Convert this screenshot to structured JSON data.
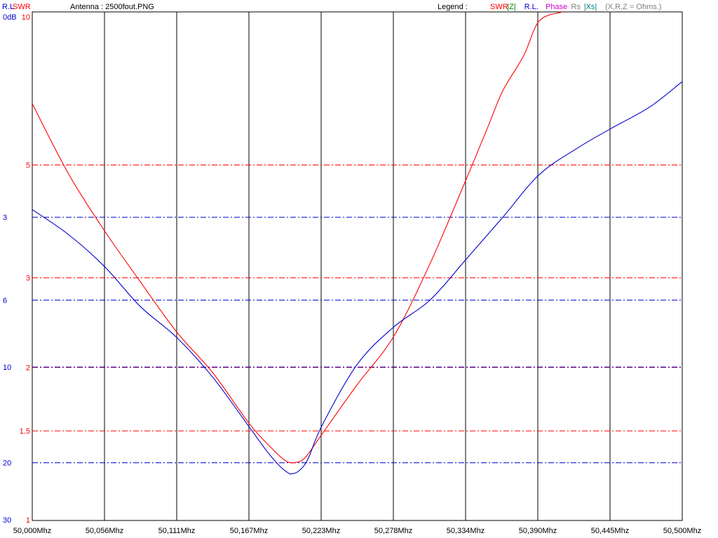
{
  "header": {
    "rl_label": "R.L",
    "swr_label": "SWR",
    "title": "Antenna : 2500fout.PNG",
    "legend_label": "Legend :",
    "legend_items": [
      {
        "text": "SWR",
        "color": "#ff0000"
      },
      {
        "text": "|Z|",
        "color": "#008000"
      },
      {
        "text": "R.L.",
        "color": "#0000cc"
      },
      {
        "text": "Phase",
        "color": "#cc00cc"
      },
      {
        "text": "Rs",
        "color": "#808080"
      },
      {
        "text": "|Xs|",
        "color": "#008080"
      },
      {
        "text": "(X,R,Z = Ohms.)",
        "color": "#808080"
      }
    ]
  },
  "colors": {
    "swr": "#ff0000",
    "rl": "#0000cc",
    "grid": "#000000",
    "swr_grid": "#ff0000",
    "rl_grid": "#0000cc"
  },
  "chart_data": {
    "type": "line",
    "x_unit": "Mhz",
    "x_ticks": [
      "50,000Mhz",
      "50,056Mhz",
      "50,111Mhz",
      "50,167Mhz",
      "50,223Mhz",
      "50,278Mhz",
      "50,334Mhz",
      "50,390Mhz",
      "50,445Mhz",
      "50,500Mhz"
    ],
    "xlim": [
      50.0,
      50.5
    ],
    "swr_axis": {
      "scale": "log",
      "ylim": [
        1,
        10
      ],
      "ticks": [
        {
          "value": 10,
          "label": "10"
        },
        {
          "value": 5,
          "label": "5"
        },
        {
          "value": 3,
          "label": "3"
        },
        {
          "value": 2,
          "label": "2"
        },
        {
          "value": 1.5,
          "label": "1.5"
        },
        {
          "value": 1,
          "label": "1"
        }
      ]
    },
    "rl_axis": {
      "unit": "dB",
      "ylim": [
        0,
        30
      ],
      "ticks": [
        {
          "value": 0,
          "label": "0dB"
        },
        {
          "value": 3,
          "label": "3"
        },
        {
          "value": 6,
          "label": "6"
        },
        {
          "value": 10,
          "label": "10"
        },
        {
          "value": 20,
          "label": "20"
        },
        {
          "value": 30,
          "label": "30"
        }
      ]
    },
    "series": [
      {
        "name": "SWR",
        "axis": "swr",
        "color": "#ff0000",
        "x": [
          50.0,
          50.028,
          50.056,
          50.083,
          50.111,
          50.139,
          50.167,
          50.185,
          50.195,
          50.202,
          50.21,
          50.223,
          50.25,
          50.278,
          50.306,
          50.334,
          50.35,
          50.362,
          50.378,
          50.39,
          50.408
        ],
        "y": [
          6.6,
          4.8,
          3.7,
          2.95,
          2.35,
          1.95,
          1.55,
          1.38,
          1.31,
          1.3,
          1.33,
          1.48,
          1.85,
          2.3,
          3.2,
          4.7,
          5.9,
          7.0,
          8.2,
          9.6,
          10.0
        ]
      },
      {
        "name": "R.L.",
        "axis": "rl",
        "color": "#0000cc",
        "x": [
          50.0,
          50.028,
          50.056,
          50.083,
          50.111,
          50.139,
          50.167,
          50.18,
          50.19,
          50.197,
          50.2,
          50.205,
          50.212,
          50.223,
          50.25,
          50.278,
          50.306,
          50.334,
          50.362,
          50.39,
          50.42,
          50.445,
          50.475,
          50.5
        ],
        "y": [
          2.8,
          3.5,
          4.6,
          6.3,
          8.0,
          10.8,
          15.5,
          18.3,
          20.4,
          21.5,
          21.6,
          21.2,
          19.5,
          15.3,
          9.8,
          7.4,
          6.0,
          4.3,
          3.0,
          2.0,
          1.5,
          1.2,
          0.9,
          0.6
        ]
      }
    ],
    "grid": true,
    "legend": "top-right"
  }
}
